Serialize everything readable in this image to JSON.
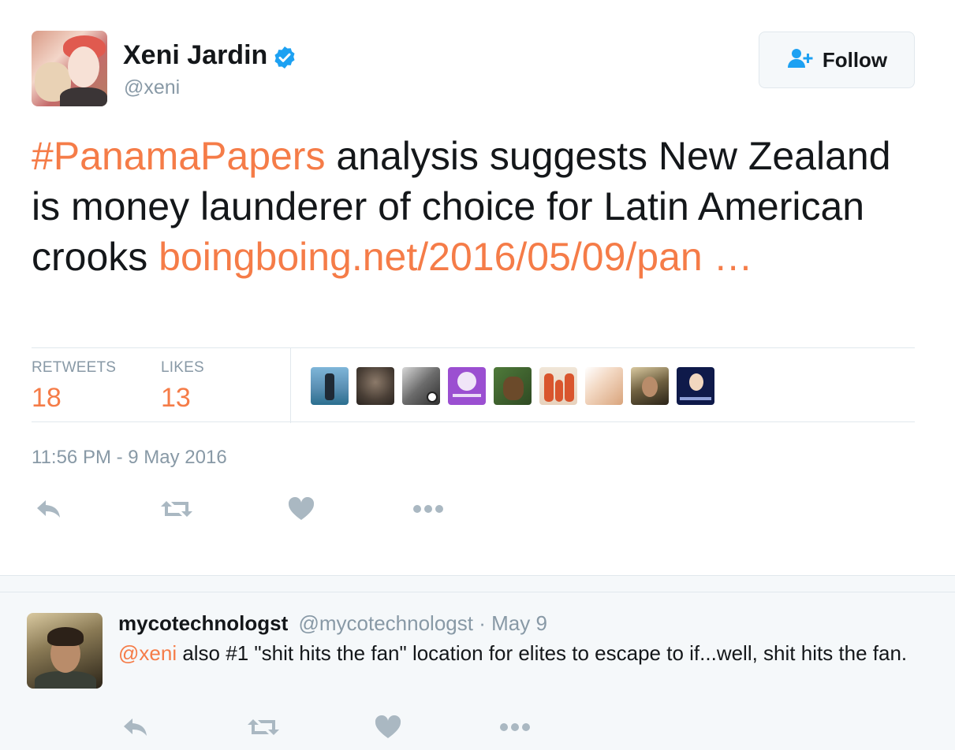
{
  "tweet": {
    "author": {
      "name": "Xeni Jardin",
      "handle": "@xeni",
      "verified": true
    },
    "follow_label": "Follow",
    "text": {
      "hashtag": "#PanamaPapers",
      "body": " analysis suggests New Zealand is money launderer of choice for Latin American crooks ",
      "link": "boingboing.net/2016/05/09/pan …"
    },
    "stats": {
      "retweets_label": "RETWEETS",
      "retweets_value": "18",
      "likes_label": "LIKES",
      "likes_value": "13"
    },
    "likers": [
      "liker-avatar-1",
      "liker-avatar-2",
      "liker-avatar-3",
      "liker-avatar-4",
      "liker-avatar-5",
      "liker-avatar-6",
      "liker-avatar-7",
      "liker-avatar-8",
      "liker-avatar-9"
    ],
    "timestamp": "11:56 PM - 9 May 2016",
    "actions": [
      "reply-icon",
      "retweet-icon",
      "like-icon",
      "more-icon"
    ]
  },
  "reply": {
    "name": "mycotechnologst",
    "handle": "@mycotechnologst",
    "separator": "·",
    "time": "May 9",
    "mention": "@xeni",
    "text": " also #1 \"shit hits the fan\" location for elites to escape to if...well, shit hits the fan."
  },
  "colors": {
    "link": "#f57c48",
    "verified": "#1da1f2",
    "muted": "#8899a6",
    "text": "#14171a",
    "action_icon": "#aab8c2"
  }
}
